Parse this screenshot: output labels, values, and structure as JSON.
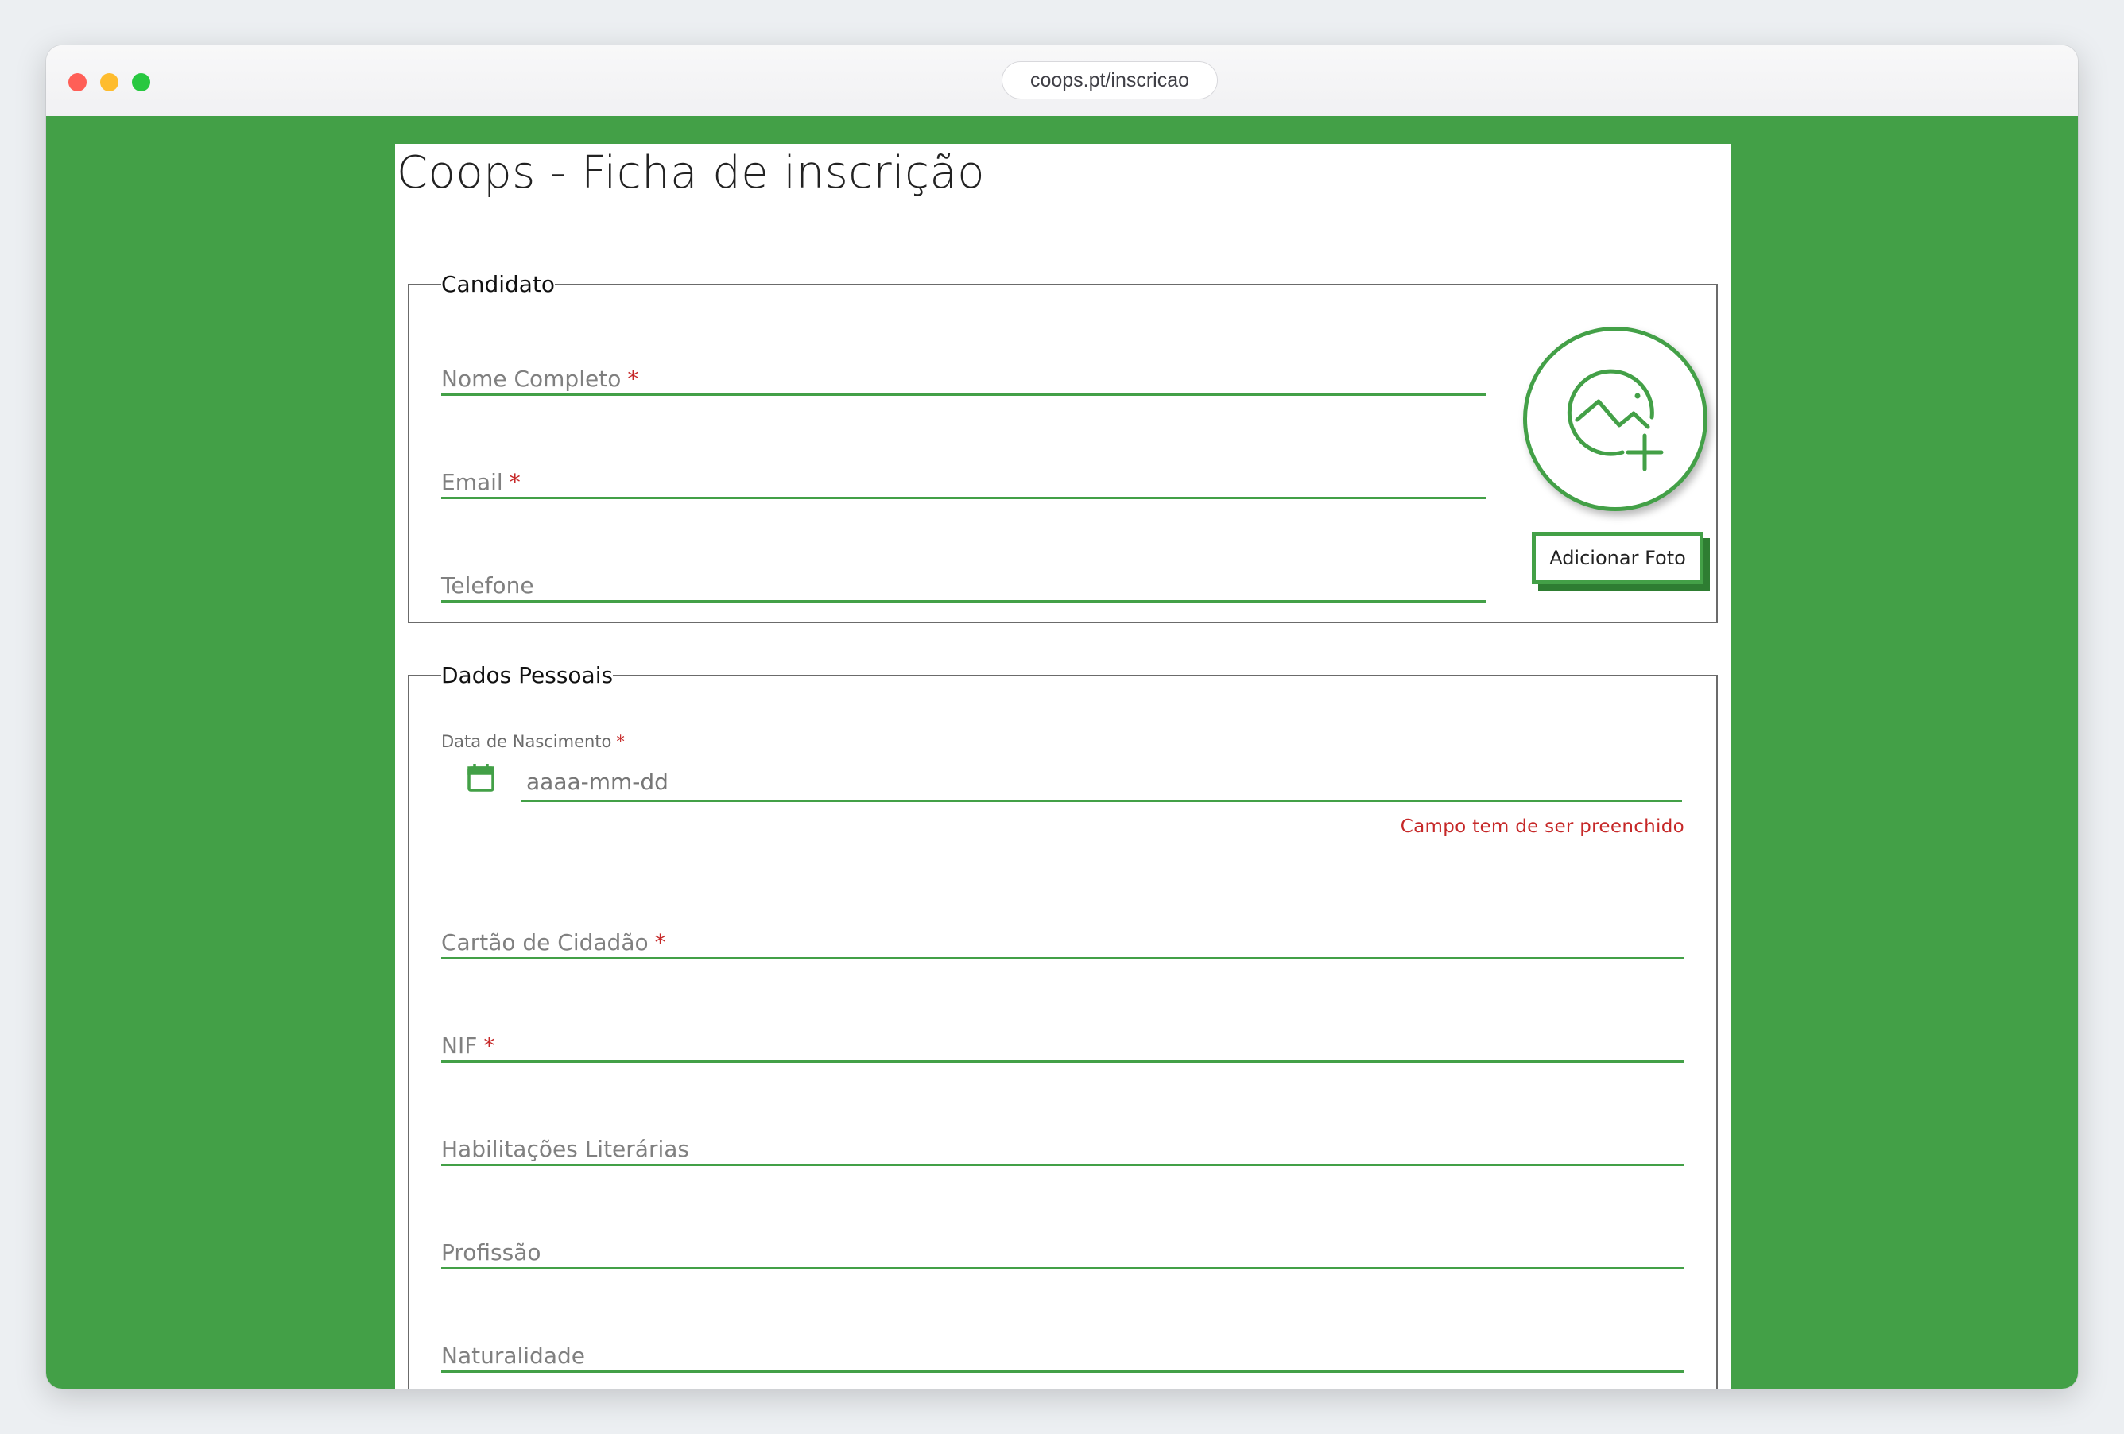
{
  "browser": {
    "url": "coops.pt/inscricao"
  },
  "page": {
    "title": "Coops - Ficha de inscrição"
  },
  "candidato": {
    "legend": "Candidato",
    "fields": [
      {
        "label": "Nome Completo",
        "required": "*"
      },
      {
        "label": "Email",
        "required": "*"
      },
      {
        "label": "Telefone",
        "required": ""
      }
    ],
    "photo_icon": "add-photo-icon",
    "add_photo_label": "Adicionar Foto"
  },
  "dados_pessoais": {
    "legend": "Dados Pessoais",
    "birth_date": {
      "label": "Data de Nascimento",
      "required": "*",
      "placeholder": "aaaa-mm-dd",
      "icon": "calendar-icon",
      "error": "Campo tem de ser preenchido"
    },
    "fields": [
      {
        "label": "Cartão de Cidadão",
        "required": "*"
      },
      {
        "label": "NIF",
        "required": "*"
      },
      {
        "label": "Habilitações Literárias",
        "required": ""
      },
      {
        "label": "Profissão",
        "required": ""
      },
      {
        "label": "Naturalidade",
        "required": ""
      }
    ]
  },
  "colors": {
    "accent": "#43a047",
    "accent_dark": "#2e7d32",
    "error": "#c62828"
  }
}
